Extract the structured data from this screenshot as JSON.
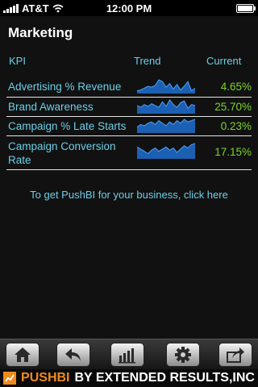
{
  "status": {
    "carrier": "AT&T",
    "time": "12:00 PM"
  },
  "title": "Marketing",
  "headers": {
    "kpi": "KPI",
    "trend": "Trend",
    "current": "Current"
  },
  "rows": [
    {
      "kpi": "Advertising % Revenue",
      "current": "4.65%",
      "trend": [
        2,
        3,
        5,
        7,
        6,
        8,
        14,
        12,
        6,
        10,
        4,
        9,
        3,
        7,
        12,
        2,
        5
      ]
    },
    {
      "kpi": "Brand Awareness",
      "current": "25.70%",
      "trend": [
        8,
        6,
        9,
        7,
        10,
        8,
        6,
        12,
        7,
        14,
        9,
        6,
        11,
        13,
        5,
        9,
        8
      ]
    },
    {
      "kpi": "Campaign % Late Starts",
      "current": "0.23%",
      "trend": [
        4,
        6,
        5,
        7,
        8,
        6,
        9,
        7,
        5,
        8,
        6,
        9,
        7,
        10,
        8,
        9,
        10
      ]
    },
    {
      "kpi": "Campaign Conversion Rate",
      "current": "17.15%",
      "trend": [
        10,
        8,
        6,
        4,
        7,
        9,
        6,
        8,
        10,
        7,
        9,
        5,
        8,
        11,
        9,
        12,
        13
      ]
    }
  ],
  "cta": "To get PushBI for your business, click here",
  "toolbar": {
    "buttons": [
      {
        "icon": "home-icon"
      },
      {
        "icon": "back-arrow-icon"
      },
      {
        "icon": "bar-chart-icon"
      },
      {
        "icon": "gear-icon"
      },
      {
        "icon": "share-icon"
      }
    ]
  },
  "brand": {
    "name": "PUSHBI",
    "tagline": "BY EXTENDED RESULTS,INC"
  },
  "colors": {
    "accent": "#6ccfe8",
    "value": "#7bd62b",
    "spark": "#1e6fd0",
    "brand": "#f18a1d"
  }
}
